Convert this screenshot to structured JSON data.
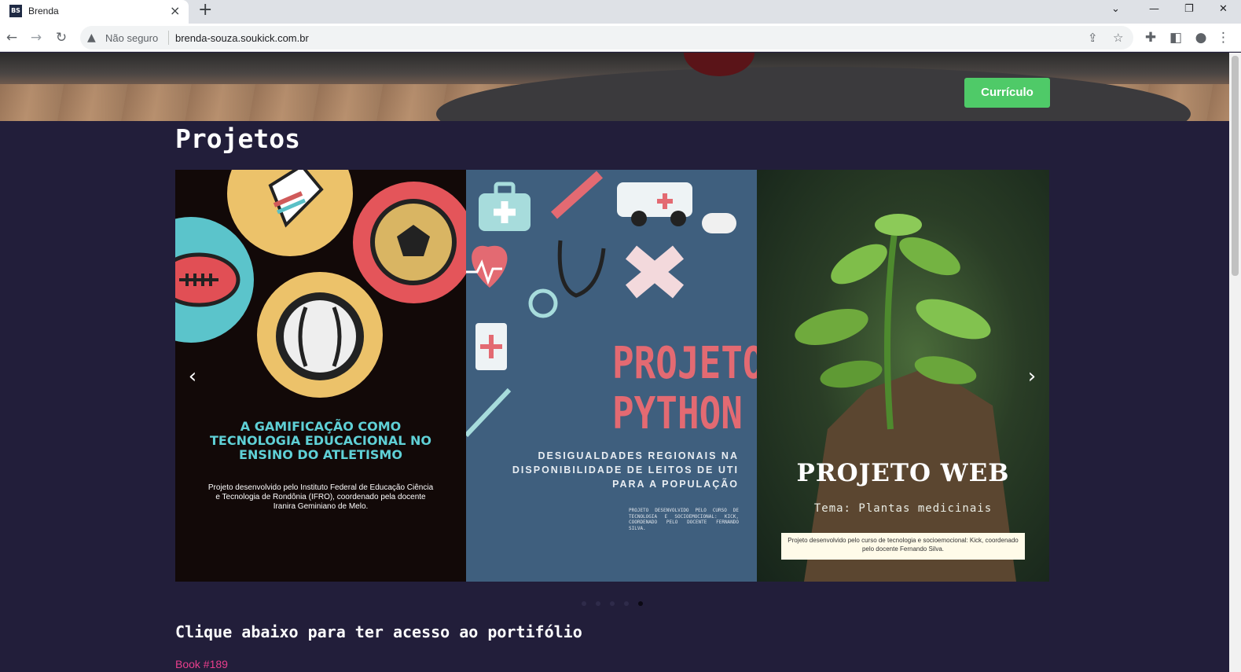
{
  "browser": {
    "tab_title": "Brenda",
    "favicon_text": "BS",
    "not_secure": "Não seguro",
    "url": "brenda-souza.soukick.com.br"
  },
  "header": {
    "cv_button": "Currículo"
  },
  "projects": {
    "title": "Projetos",
    "slides": [
      {
        "title": "A GAMIFICAÇÃO COMO TECNOLOGIA EDUCACIONAL NO ENSINO DO ATLETISMO",
        "description": "Projeto desenvolvido pelo Instituto Federal de Educação Ciência e Tecnologia de Rondônia (IFRO), coordenado pela docente Iranira Geminiano de Melo."
      },
      {
        "title": "PROJETO PYTHON",
        "subtitle": "DESIGUALDADES REGIONAIS NA DISPONIBILIDADE DE LEITOS DE UTI PARA A POPULAÇÃO",
        "note": "PROJETO DESENVOLVIDO PELO CURSO DE TECNOLOGIA E SOCIOEMOCIONAL: KICK, COORDENADO PELO DOCENTE FERNANDO SILVA."
      },
      {
        "title": "PROJETO WEB",
        "subtitle": "Tema: Plantas medicinais",
        "note": "Projeto desenvolvido pelo curso de tecnologia e socioemocional: Kick, coordenado pelo docente Fernando Silva."
      }
    ],
    "indicator_count": 5,
    "active_indicator": 5
  },
  "portfolio": {
    "title": "Clique abaixo para ter acesso ao portifólio",
    "link_text": "Book #189"
  },
  "colors": {
    "page_bg": "#221e3a",
    "cv_button": "#4fca68",
    "link": "#e83e8c"
  }
}
